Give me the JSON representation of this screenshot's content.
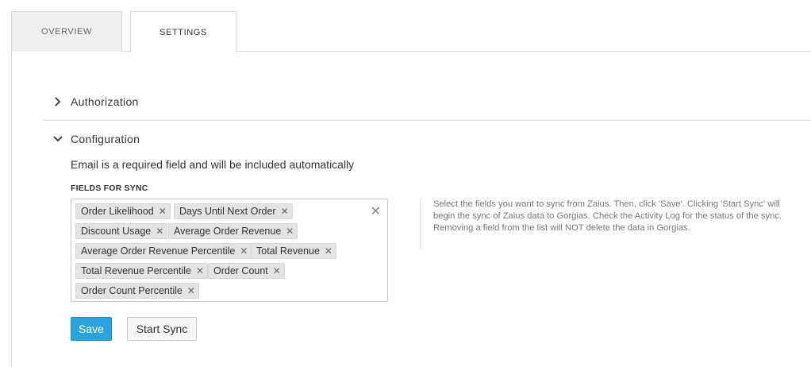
{
  "tabs": {
    "overview": "OVERVIEW",
    "settings": "SETTINGS"
  },
  "sections": {
    "authorization": "Authorization",
    "configuration": "Configuration"
  },
  "config": {
    "note": "Email is a required field and will be included automatically",
    "fields_label": "FIELDS FOR SYNC",
    "selected_fields": [
      "Order Likelihood",
      "Days Until Next Order",
      "Discount Usage",
      "Average Order Revenue",
      "Average Order Revenue Percentile",
      "Total Revenue",
      "Total Revenue Percentile",
      "Order Count",
      "Order Count Percentile"
    ],
    "help_text": "Select the fields you want to sync from Zaius. Then, click 'Save'. Clicking 'Start Sync' will begin the sync of Zaius data to Gorgias. Check the Activity Log for the status of the sync. Removing a field from the list will NOT delete the data in Gorgias."
  },
  "buttons": {
    "save": "Save",
    "start_sync": "Start Sync"
  },
  "colors": {
    "accent": "#2aa3de",
    "chip_bg": "#e4e4e4"
  }
}
